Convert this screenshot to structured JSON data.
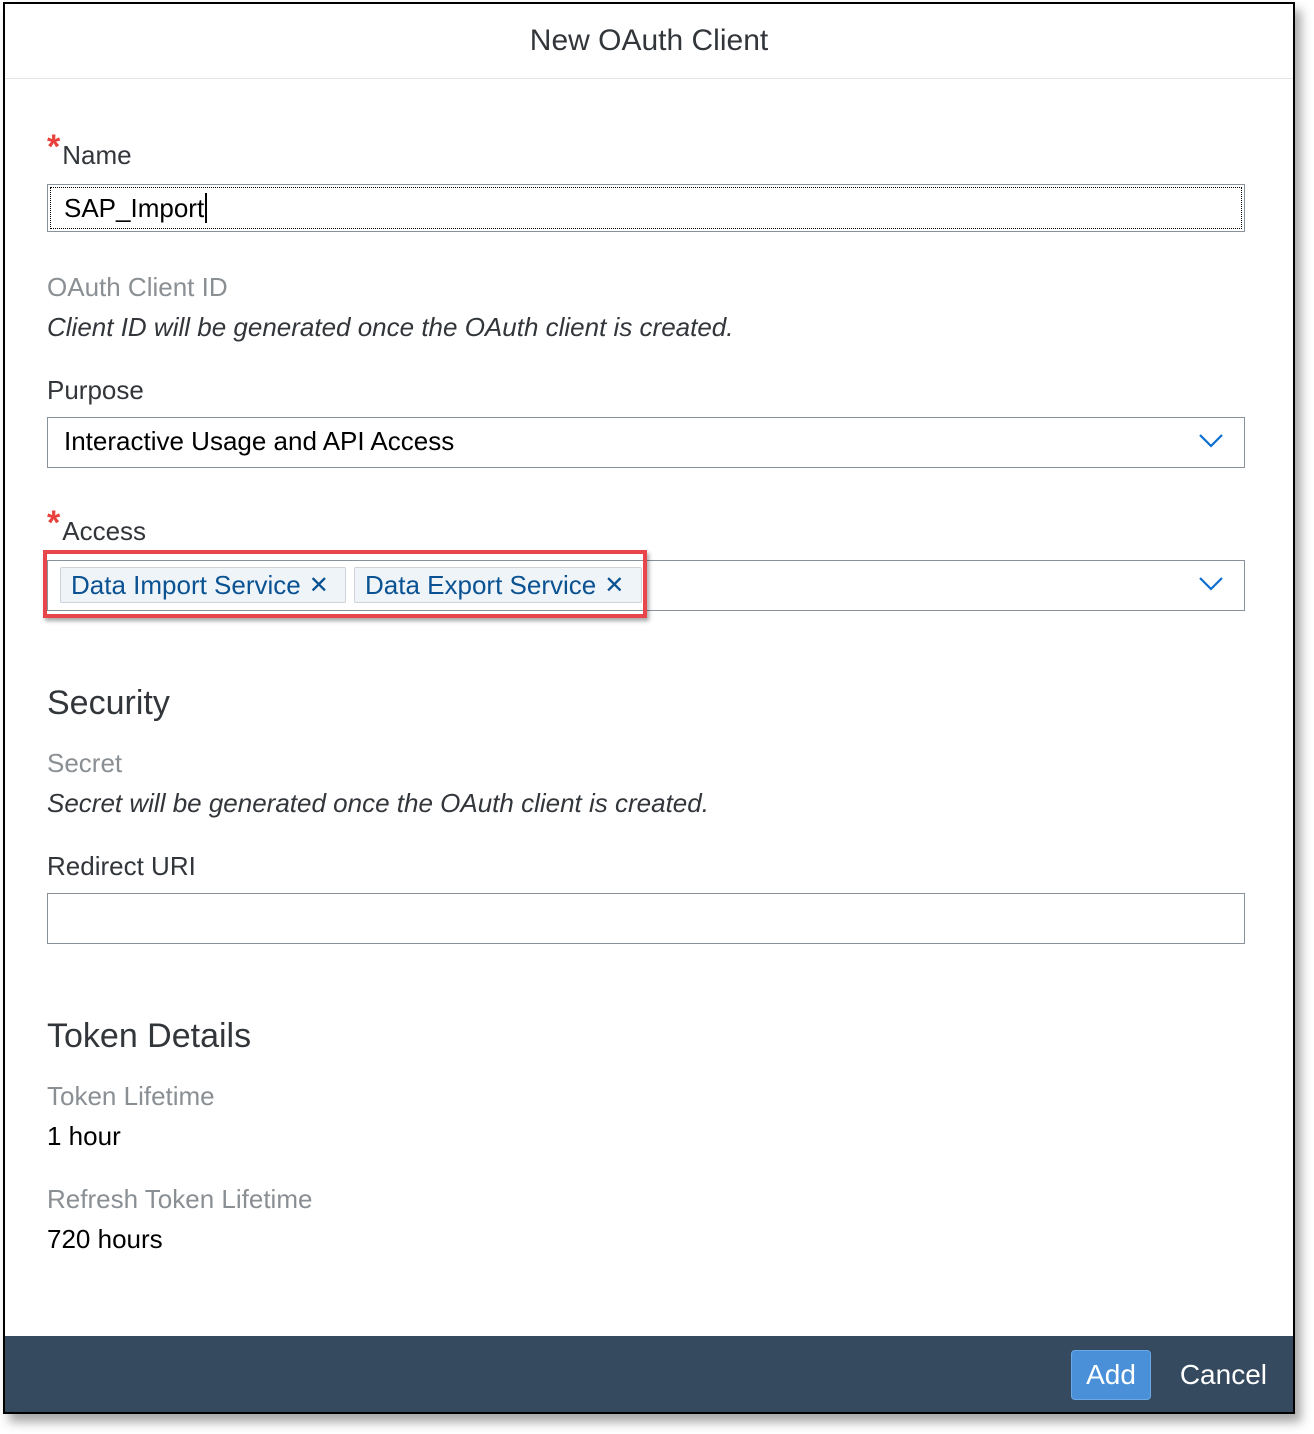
{
  "dialog": {
    "title": "New OAuth Client"
  },
  "name_field": {
    "required_marker": "*",
    "label": "Name",
    "value": "SAP_Import"
  },
  "client_id": {
    "label": "OAuth Client ID",
    "note": "Client ID will be generated once the OAuth client is created."
  },
  "purpose": {
    "label": "Purpose",
    "selected": "Interactive Usage and API Access"
  },
  "access": {
    "required_marker": "*",
    "label": "Access",
    "tokens": [
      {
        "label": "Data Import Service",
        "remove": "✕"
      },
      {
        "label": "Data Export Service",
        "remove": "✕"
      }
    ]
  },
  "security": {
    "heading": "Security",
    "secret_label": "Secret",
    "secret_note": "Secret will be generated once the OAuth client is created.",
    "redirect_label": "Redirect URI",
    "redirect_value": ""
  },
  "token_details": {
    "heading": "Token Details",
    "lifetime_label": "Token Lifetime",
    "lifetime_value": "1 hour",
    "refresh_label": "Refresh Token Lifetime",
    "refresh_value": "720 hours"
  },
  "footer": {
    "add_label": "Add",
    "cancel_label": "Cancel"
  },
  "colors": {
    "footer_bg": "#354a5f",
    "primary_button": "#4a90d9",
    "required": "#e9413e",
    "highlight": "#e8464c",
    "token_text": "#0a5291"
  }
}
